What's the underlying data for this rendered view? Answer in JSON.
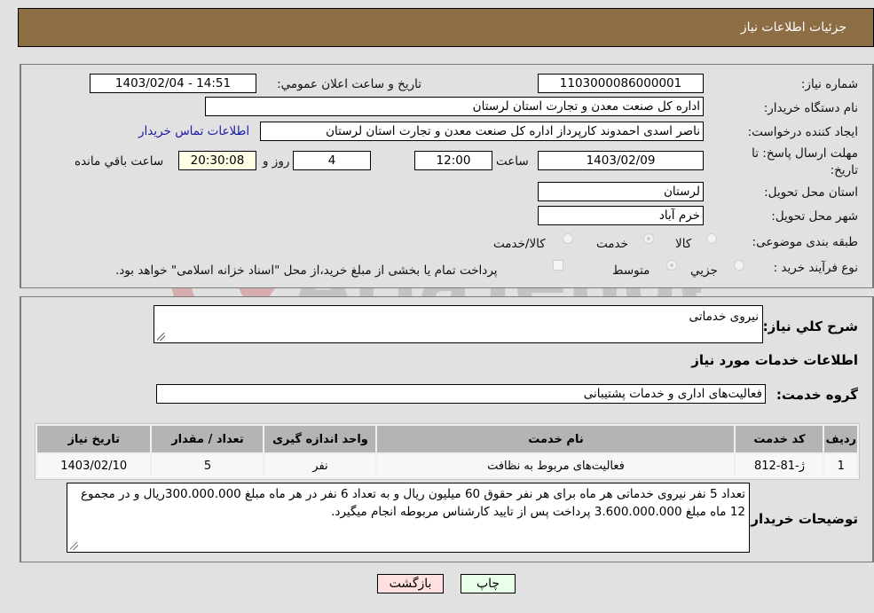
{
  "header": {
    "title": "جزئیات اطلاعات نیاز"
  },
  "form": {
    "need_number": {
      "label": "شماره نیاز:",
      "value": "1103000086000001"
    },
    "announce_datetime": {
      "label": "تاريخ و ساعت اعلان عمومي:",
      "value": "1403/02/04 - 14:51"
    },
    "buyer_org": {
      "label": "نام دستگاه خریدار:",
      "value": "اداره کل صنعت  معدن و تجارت استان لرستان"
    },
    "requester": {
      "label": "ایجاد کننده درخواست:",
      "value": "ناصر اسدی احمدوند کارپرداز اداره کل صنعت  معدن و تجارت استان لرستان"
    },
    "buyer_contact_link": "اطلاعات تماس خریدار",
    "deadline": {
      "label": "مهلت ارسال پاسخ: تا تاریخ:",
      "date": "1403/02/09",
      "time_label": "ساعت",
      "time": "12:00",
      "days": "4",
      "days_label": "روز و",
      "remaining": "20:30:08",
      "remaining_label": "ساعت باقي مانده"
    },
    "province": {
      "label": "استان محل تحویل:",
      "value": "لرستان"
    },
    "city": {
      "label": "شهر محل تحویل:",
      "value": "خرم آباد"
    },
    "category": {
      "label": "طبقه بندی موضوعی:",
      "options": [
        "کالا",
        "خدمت",
        "کالا/خدمت"
      ],
      "selected": "خدمت"
    },
    "purchase_type": {
      "label": "نوع فرآیند خرید :",
      "options": [
        "جزيي",
        "متوسط"
      ],
      "selected": "متوسط",
      "treasury_note": "پرداخت تمام یا بخشی از مبلغ خرید،از محل \"اسناد خزانه اسلامی\" خواهد بود.",
      "treasury_checked": false
    }
  },
  "details": {
    "summary_label": "شرح کلي نياز:",
    "summary_value": "نیروی خدماتی",
    "services_heading": "اطلاعات خدمات مورد نیاز",
    "service_group_label": "گروه خدمت:",
    "service_group_value": "فعالیت‌های اداری و خدمات پشتیبانی",
    "table": {
      "headers": [
        "ردیف",
        "کد خدمت",
        "نام خدمت",
        "واحد اندازه گیری",
        "تعداد / مقدار",
        "تاریخ نیاز"
      ],
      "rows": [
        [
          "1",
          "ژ-81-812",
          "فعالیت‌های مربوط به نظافت",
          "نفر",
          "5",
          "1403/02/10"
        ]
      ]
    },
    "buyer_notes_label": "توضیحات خریدار:",
    "buyer_notes_value": "تعداد 5 نفر نیروی خدماتی هر ماه برای هر نفر حقوق 60 میلیون ریال و به تعداد 6 نفر در هر ماه مبلغ 300.000.000ریال و در مجموع 12 ماه مبلغ 3.600.000.000 پرداخت پس از تایید کارشناس مربوطه انجام میگیرد."
  },
  "buttons": {
    "print": "چاپ",
    "back": "بازگشت"
  },
  "watermark": {
    "text": "AriaTender.neT"
  },
  "colors": {
    "header_bg": "#8c6d44",
    "link": "#1a1aa6",
    "back_btn": "#ffe0e0",
    "print_btn": "#e8ffe8"
  }
}
